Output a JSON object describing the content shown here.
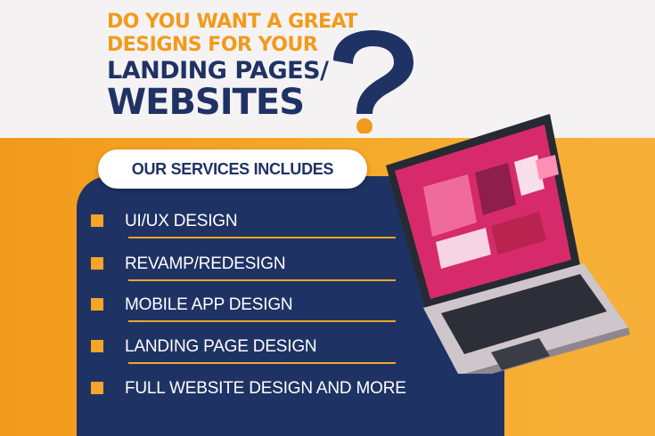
{
  "headline": {
    "line1": "DO YOU WANT A GREAT",
    "line2": "DESIGNS FOR YOUR",
    "line3": "LANDING PAGES/",
    "line4": "WEBSITES"
  },
  "services": {
    "heading": "OUR SERVICES INCLUDES",
    "items": [
      {
        "label": "UI/UX DESIGN"
      },
      {
        "label": "REVAMP/REDESIGN"
      },
      {
        "label": "MOBILE APP DESIGN"
      },
      {
        "label": "LANDING PAGE DESIGN"
      },
      {
        "label": "FULL WEBSITE DESIGN AND MORE"
      }
    ]
  },
  "colors": {
    "navy": "#1f3264",
    "orange": "#f29a1b",
    "background_top": "#f4f2f3",
    "white": "#ffffff"
  },
  "icons": {
    "question_mark": "question-mark-icon",
    "bullet": "square-bullet-icon",
    "laptop": "laptop-illustration"
  }
}
